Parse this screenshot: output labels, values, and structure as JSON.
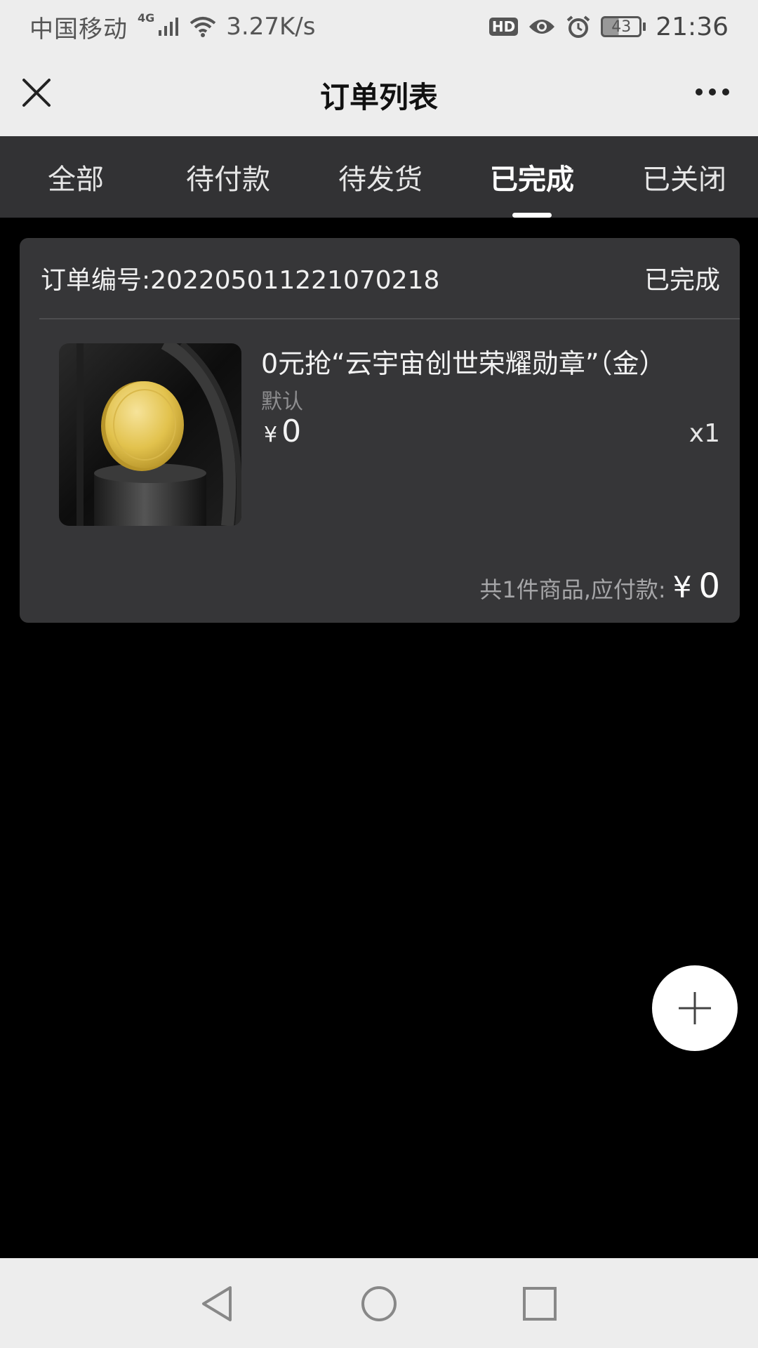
{
  "status_bar": {
    "carrier": "中国移动",
    "network_badge": "4G",
    "speed": "3.27K/s",
    "hd_badge": "HD",
    "battery_level": "43",
    "time": "21:36",
    "icons": [
      "signal-icon",
      "wifi-icon",
      "eye-icon",
      "alarm-icon",
      "battery-icon"
    ]
  },
  "nav": {
    "title": "订单列表",
    "close_icon": "close-icon",
    "more_icon": "more-icon"
  },
  "tabs": [
    {
      "label": "全部",
      "active": false
    },
    {
      "label": "待付款",
      "active": false
    },
    {
      "label": "待发货",
      "active": false
    },
    {
      "label": "已完成",
      "active": true
    },
    {
      "label": "已关闭",
      "active": false
    }
  ],
  "order": {
    "number_label": "订单编号:",
    "number": "202205011221070218",
    "status": "已完成",
    "item": {
      "name": "0元抢“云宇宙创世荣耀勋章”（金）",
      "spec": "默认",
      "currency": "¥",
      "price": "0",
      "quantity": "x1"
    },
    "total_label": "共1件商品,应付款:",
    "total_currency": "¥",
    "total_amount": "0"
  },
  "fab": {
    "icon": "plus-icon"
  },
  "system_nav": {
    "icons": [
      "back-icon",
      "home-icon",
      "recents-icon"
    ]
  },
  "colors": {
    "background": "#000000",
    "tab_bar": "#323234",
    "card": "#363638",
    "chrome": "#ededed"
  }
}
